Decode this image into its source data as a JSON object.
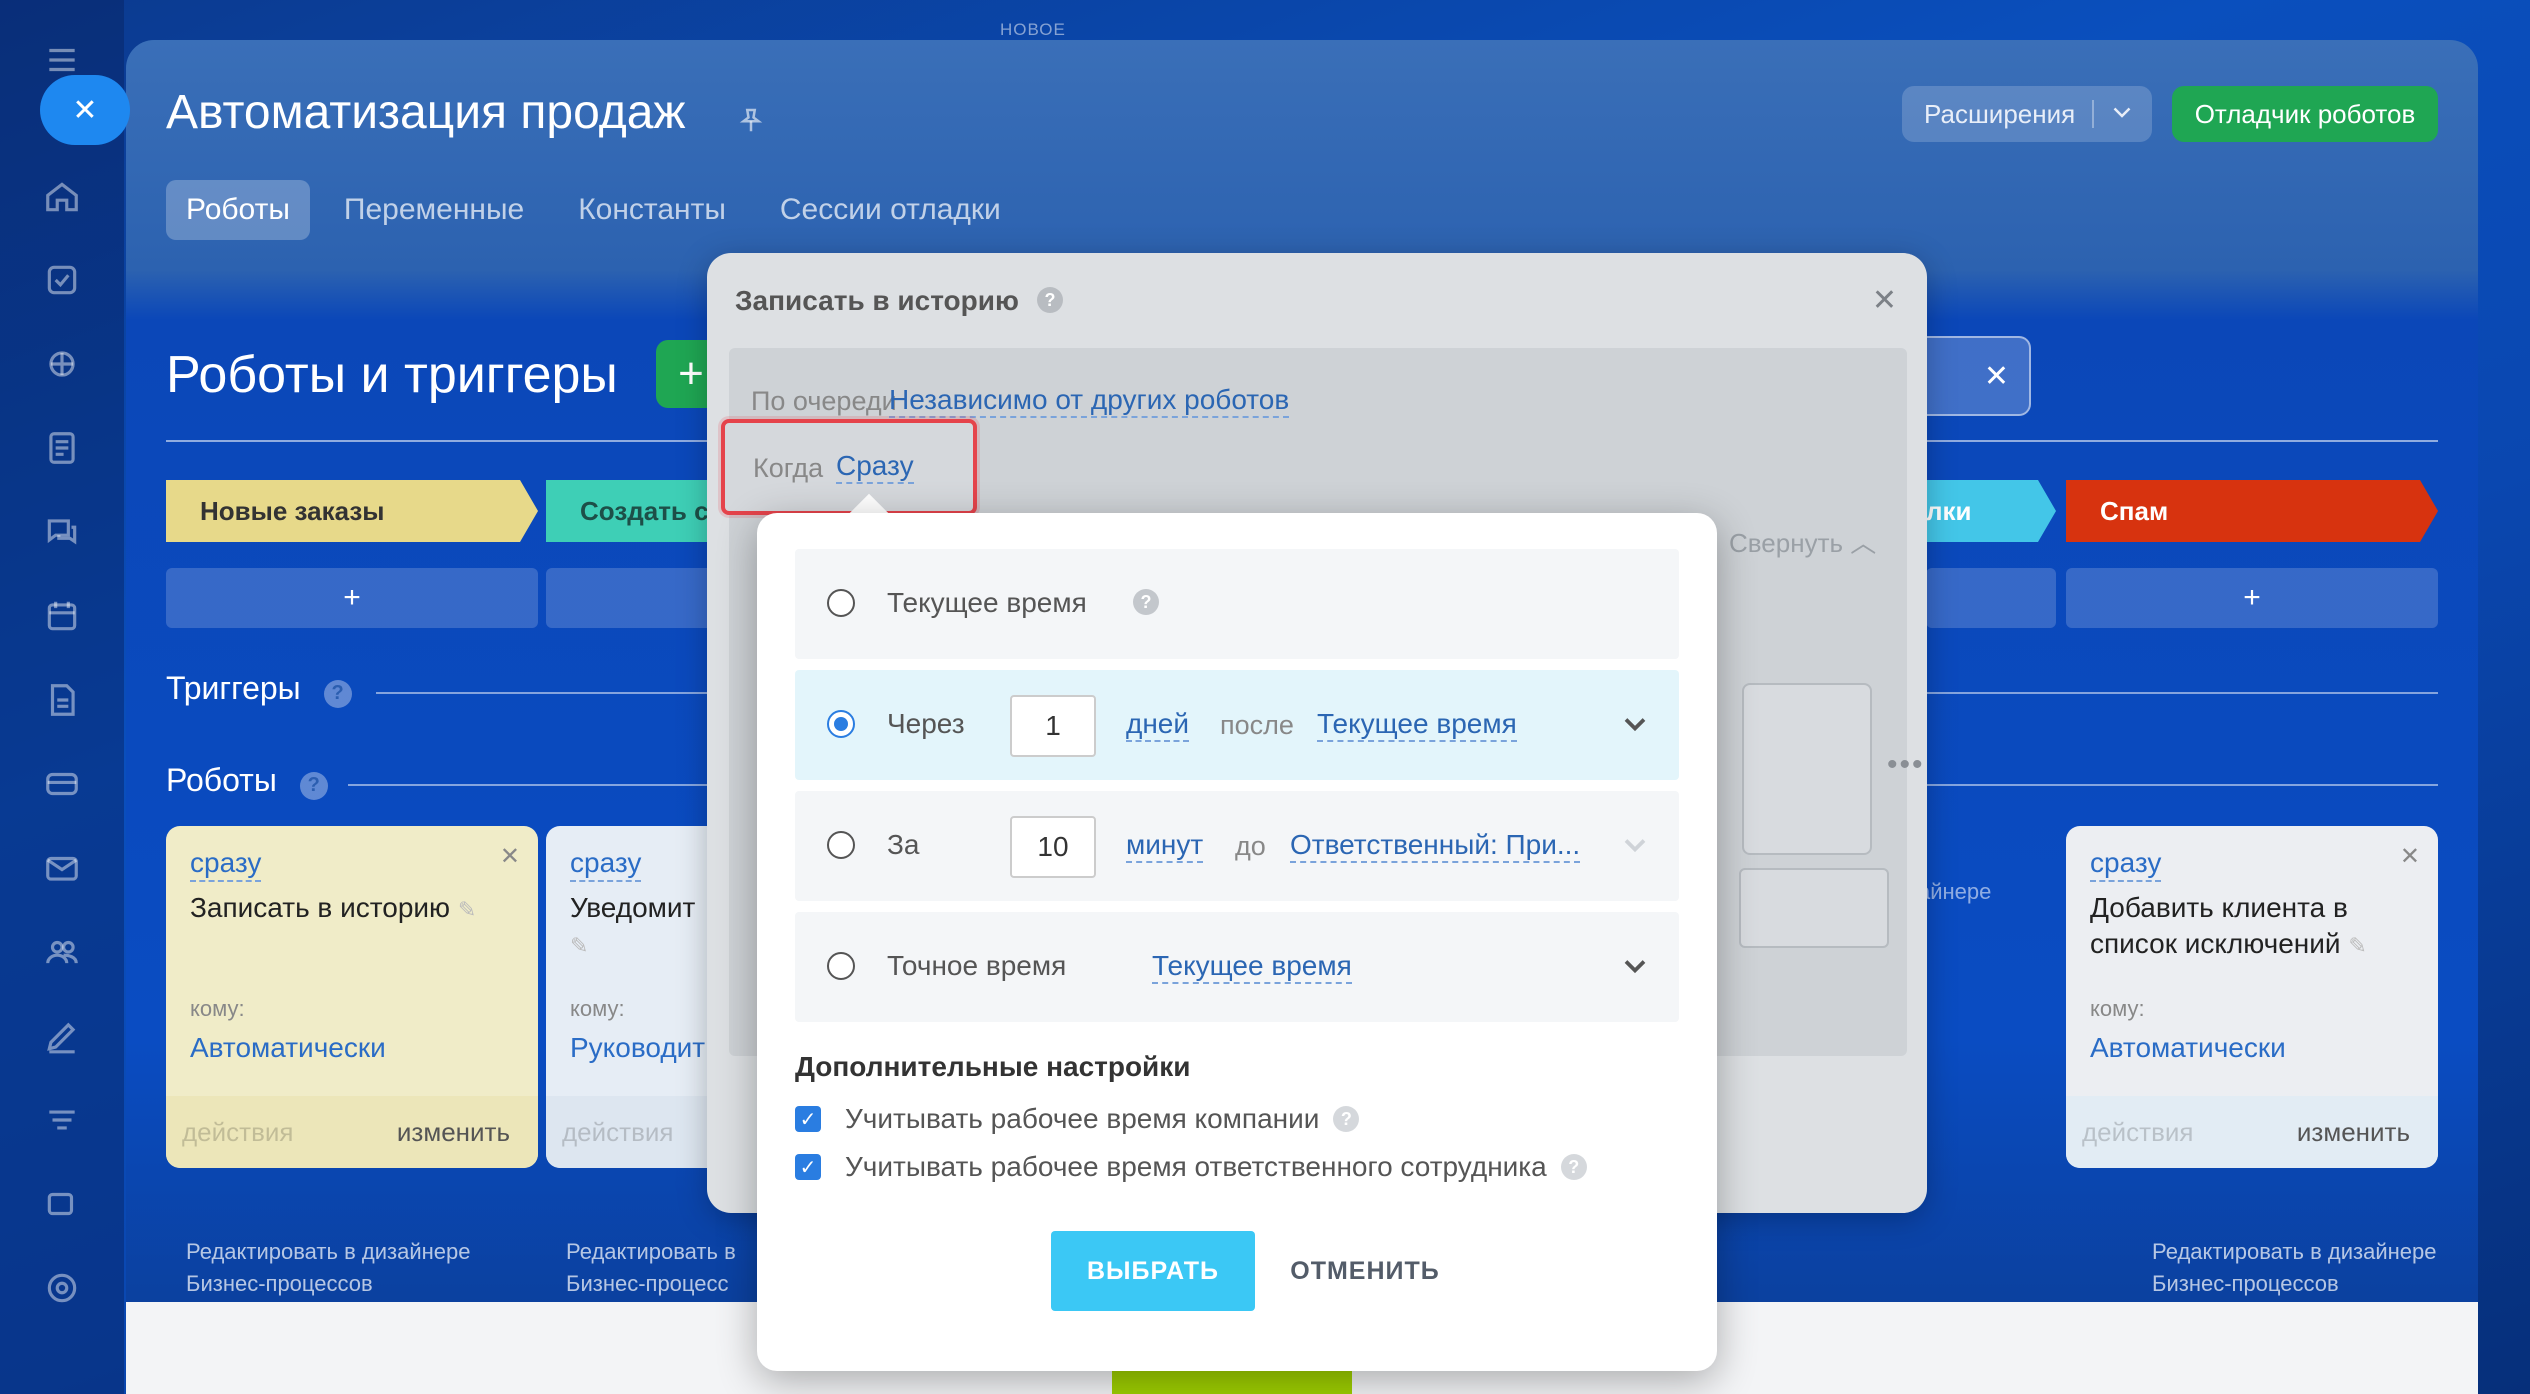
{
  "top_hint": "НОВОЕ",
  "sidebar": {
    "icons": [
      "menu-icon",
      "home-icon",
      "tasks-icon",
      "crm-icon",
      "feed-icon",
      "chat-icon",
      "calendar-icon",
      "documents-icon",
      "sales-icon",
      "mail-icon",
      "contacts-icon",
      "sign-icon",
      "automation-icon",
      "other-icon",
      "settings-icon"
    ]
  },
  "header": {
    "title": "Автоматизация продаж",
    "extensions_label": "Расширения",
    "debugger_label": "Отладчик роботов",
    "tabs": [
      {
        "label": "Роботы",
        "active": true
      },
      {
        "label": "Переменные",
        "active": false
      },
      {
        "label": "Константы",
        "active": false
      },
      {
        "label": "Сессии отладки",
        "active": false
      }
    ]
  },
  "main": {
    "title": "Роботы и триггеры",
    "add_label": "+",
    "clear_label": "✕",
    "stages": [
      {
        "label": "Новые заказы",
        "color": "#e7d98a",
        "text_color": "#333333"
      },
      {
        "label": "Создать с",
        "color": "#3ecfb6",
        "text_color": "#1d4f48"
      },
      {
        "label": "лки",
        "color": "#43c6e8",
        "text_color": "#ffffff"
      },
      {
        "label": "Спам",
        "color": "#d7330f",
        "text_color": "#ffffff"
      }
    ],
    "stage_add_label": "+",
    "triggers_label": "Триггеры",
    "robots_label": "Роботы",
    "help_label": "?",
    "cards": [
      {
        "when": "сразу",
        "name": "Записать в историю",
        "whom_label": "кому:",
        "responsible": "Автоматически",
        "actions": "действия",
        "edit": "изменить",
        "bg": "#f0ecc8",
        "foot_bg": "#ece6b9"
      },
      {
        "when": "сразу",
        "name": "Уведомит",
        "whom_label": "кому:",
        "responsible": "Руководит",
        "actions": "действия",
        "edit": "изменить",
        "bg": "#e6edf5",
        "foot_bg": "#dde6f0"
      },
      {
        "when": "сразу",
        "name": "Добавить клиента в список исключений",
        "whom_label": "кому:",
        "responsible": "Автоматически",
        "actions": "действия",
        "edit": "изменить",
        "bg": "#eceef2",
        "foot_bg": "#e2ecf4"
      }
    ],
    "edit_in_designer": [
      "Редактировать в дизайнере",
      "Бизнес-процессов"
    ],
    "edit_in_designer_short": "Редактировать в дизайнере",
    "edit_in_designer_cut": [
      "Редактировать в",
      "Бизнес-процесс"
    ],
    "ghost_designer": "айнере"
  },
  "dialog": {
    "title": "Записать в историю",
    "help": "?",
    "close": "✕",
    "queue_label": "По очереди",
    "queue_value": "Независимо от других роботов",
    "when_label": "Когда",
    "when_value": "Сразу",
    "collapse_label": "Свернуть",
    "dots": "•••"
  },
  "popup": {
    "options": [
      {
        "label": "Текущее время",
        "selected": false
      },
      {
        "label": "Через",
        "selected": true,
        "number": "1",
        "unit": "дней",
        "relation": "после",
        "reference": "Текущее время"
      },
      {
        "label": "За",
        "selected": false,
        "number": "10",
        "unit": "минут",
        "relation": "до",
        "reference": "Ответственный: При..."
      },
      {
        "label": "Точное время",
        "selected": false,
        "reference": "Текущее время"
      }
    ],
    "advanced_title": "Дополнительные настройки",
    "checkboxes": [
      {
        "label": "Учитывать рабочее время компании",
        "checked": true
      },
      {
        "label": "Учитывать рабочее время ответственного сотрудника",
        "checked": true
      }
    ],
    "select_label": "ВЫБРАТЬ",
    "cancel_label": "ОТМЕНИТЬ"
  }
}
